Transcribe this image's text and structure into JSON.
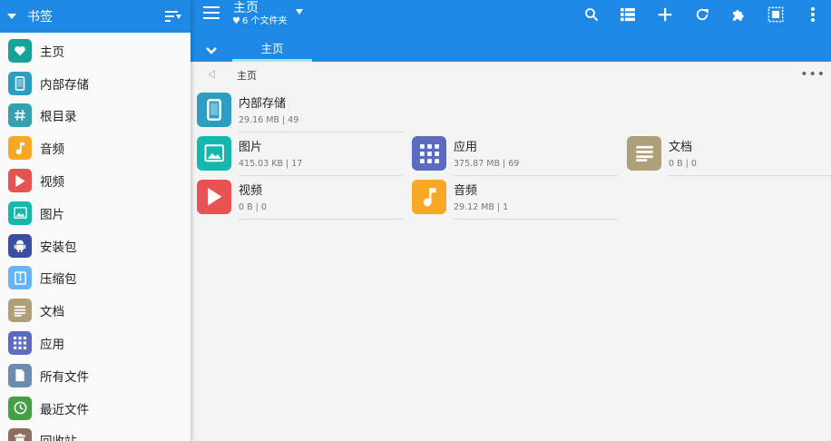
{
  "sidebar": {
    "title": "书签",
    "items": [
      {
        "label": "主页",
        "icon": "heart-icon",
        "color": "#17a398"
      },
      {
        "label": "内部存储",
        "icon": "phone-icon",
        "color": "#2b9ec1"
      },
      {
        "label": "根目录",
        "icon": "hash-icon",
        "color": "#36a0b0"
      },
      {
        "label": "音频",
        "icon": "music-note-icon",
        "color": "#f9a825"
      },
      {
        "label": "视频",
        "icon": "play-icon",
        "color": "#e85252"
      },
      {
        "label": "图片",
        "icon": "image-icon",
        "color": "#16b8ad"
      },
      {
        "label": "安装包",
        "icon": "android-icon",
        "color": "#3b4fa1"
      },
      {
        "label": "压缩包",
        "icon": "archive-icon",
        "color": "#64b5f6"
      },
      {
        "label": "文档",
        "icon": "document-icon",
        "color": "#b0a07a"
      },
      {
        "label": "应用",
        "icon": "apps-grid-icon",
        "color": "#5c6bc0"
      },
      {
        "label": "所有文件",
        "icon": "file-icon",
        "color": "#6a8caf"
      },
      {
        "label": "最近文件",
        "icon": "clock-icon",
        "color": "#43a047"
      },
      {
        "label": "回收站",
        "icon": "trash-icon",
        "color": "#8d6e63"
      }
    ]
  },
  "appbar": {
    "title": "主页",
    "subtitle": "6 个文件夹",
    "tab": "主页",
    "actions": [
      "search-icon",
      "list-view-icon",
      "add-icon",
      "refresh-icon",
      "puzzle-icon",
      "select-all-icon",
      "more-vert-icon"
    ]
  },
  "breadcrumb": {
    "path": "主页"
  },
  "tiles": [
    {
      "name": "内部存储",
      "meta": "29.16 MB | 49",
      "icon": "phone-icon",
      "color": "#2b9ec1"
    },
    {
      "name": "图片",
      "meta": "415.03  KB | 17",
      "icon": "image-icon",
      "color": "#16b8ad"
    },
    {
      "name": "应用",
      "meta": "375.87 MB | 69",
      "icon": "apps-grid-icon",
      "color": "#5c6bc0"
    },
    {
      "name": "文档",
      "meta": "0 B | 0",
      "icon": "document-icon",
      "color": "#b0a07a"
    },
    {
      "name": "视频",
      "meta": "0 B | 0",
      "icon": "play-icon",
      "color": "#e85252"
    },
    {
      "name": "音频",
      "meta": "29.12 MB | 1",
      "icon": "music-note-icon",
      "color": "#f9a825"
    }
  ],
  "colors": {
    "primary": "#1e88e5",
    "tab_indicator": "#9fe3f5"
  }
}
